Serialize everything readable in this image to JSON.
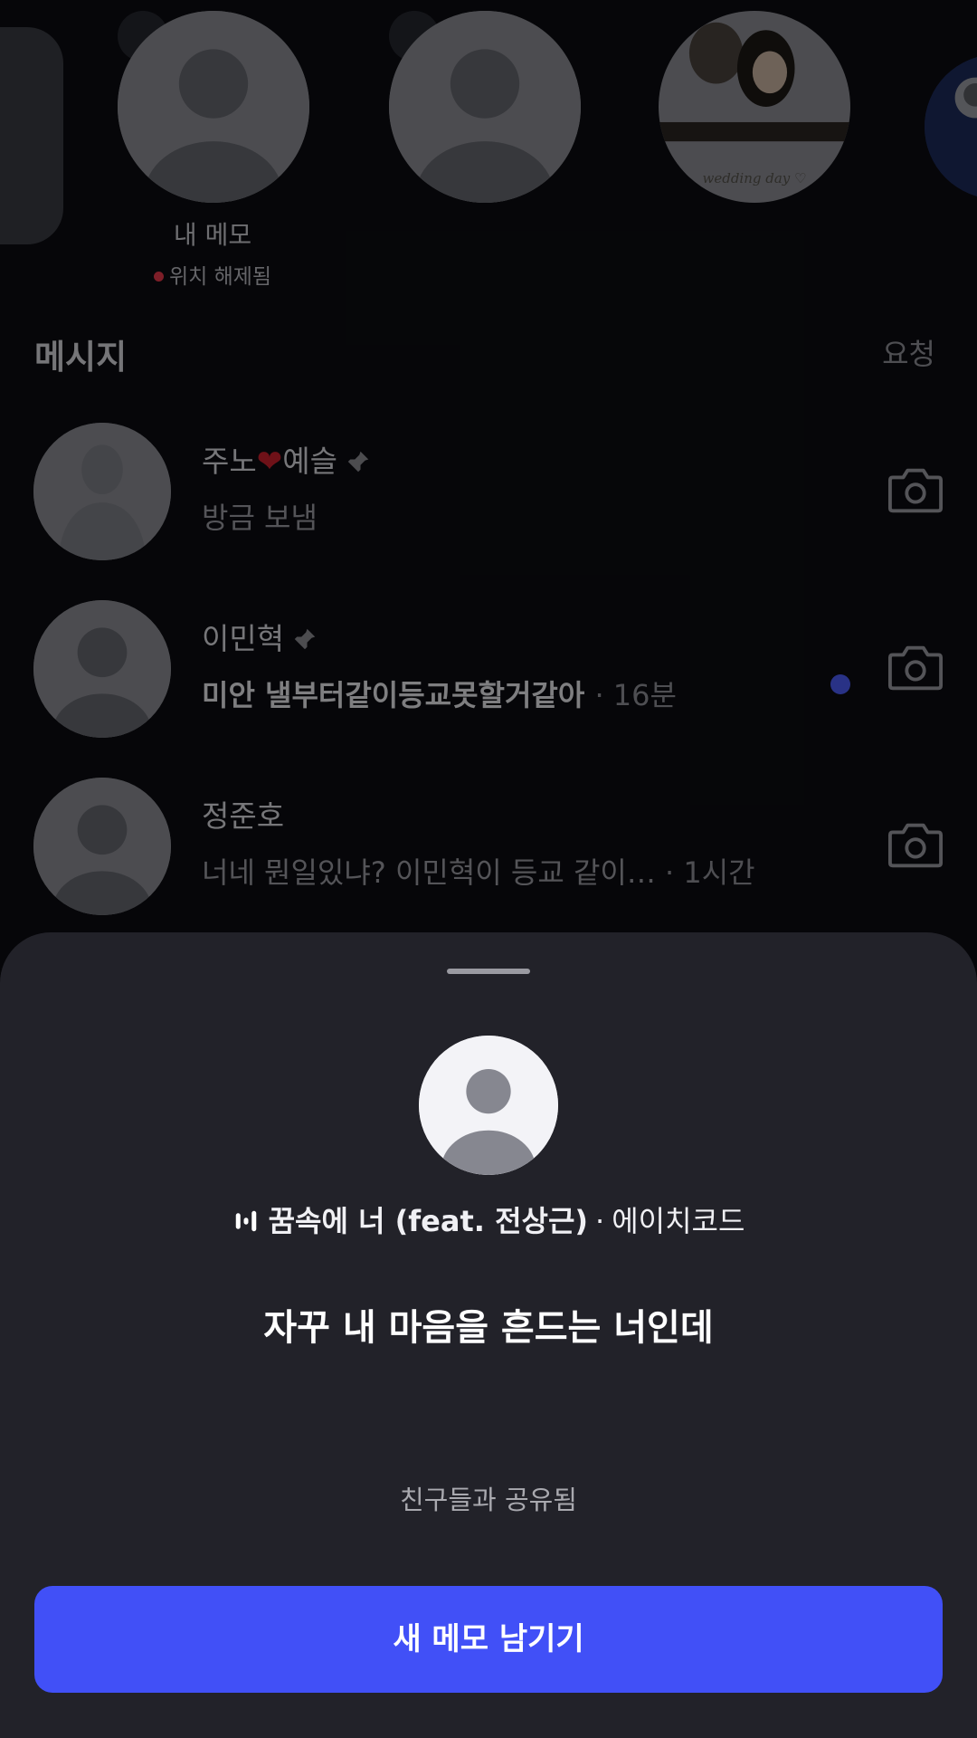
{
  "notes": {
    "my_note": {
      "label": "내 메모",
      "status": "위치 해제됨"
    },
    "photo_note": {
      "caption": "wedding day ♡"
    }
  },
  "messages": {
    "title": "메시지",
    "requests": "요청",
    "rows": [
      {
        "name_prefix": "주노",
        "name_heart": "❤",
        "name_suffix": "예슬",
        "pinned": true,
        "preview": "방금 보냄",
        "time": "",
        "unread": false
      },
      {
        "name": "이민혁",
        "pinned": true,
        "preview": "미안 낼부터같이등교못할거같아",
        "time": "· 16분",
        "unread": true
      },
      {
        "name": "정준호",
        "pinned": false,
        "preview": "너네 뭔일있냐? 이민혁이 등교 같이…",
        "time": "· 1시간",
        "unread": false
      }
    ]
  },
  "sheet": {
    "song": "꿈속에 너 (feat. 전상근)",
    "separator": "·",
    "artist": "에이치코드",
    "note_text": "자꾸 내 마음을 흔드는 너인데",
    "shared": "친구들과 공유됨",
    "button": "새 메모 남기기"
  },
  "colors": {
    "accent": "#4150F7",
    "unread_dot": "#4B5CF5",
    "sheet_bg": "#222229",
    "status_dot": "#E3384A"
  },
  "icons": [
    "camera-icon",
    "pin-icon",
    "equalizer-icon",
    "avatar-placeholder-icon"
  ]
}
